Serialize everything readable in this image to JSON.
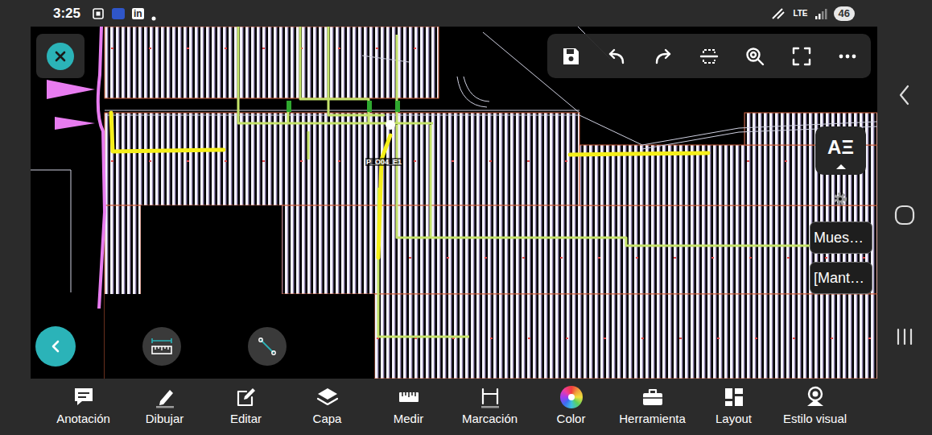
{
  "status_bar": {
    "time": "3:25",
    "app_badge": "in",
    "network": "LTE",
    "battery": "46"
  },
  "drawing": {
    "label": "P_O04_E1"
  },
  "text_style_button": {
    "label": "AΞ"
  },
  "side_buttons": [
    {
      "label": "Mues…"
    },
    {
      "label": "[Mant…"
    }
  ],
  "toolbar": [
    {
      "label": "Anotación"
    },
    {
      "label": "Dibujar"
    },
    {
      "label": "Editar"
    },
    {
      "label": "Capa"
    },
    {
      "label": "Medir"
    },
    {
      "label": "Marcación"
    },
    {
      "label": "Color"
    },
    {
      "label": "Herramienta"
    },
    {
      "label": "Layout"
    },
    {
      "label": "Estilo visual"
    }
  ]
}
